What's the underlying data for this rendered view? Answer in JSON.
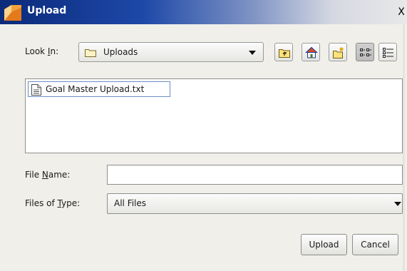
{
  "window": {
    "title": "Upload",
    "close_label": "X"
  },
  "look_in": {
    "label_pre": "Look ",
    "label_mnemonic": "I",
    "label_post": "n:",
    "value": "Uploads"
  },
  "toolbar": {
    "icons": [
      "up-one-level-icon",
      "home-icon",
      "new-folder-icon",
      "list-view-icon",
      "details-view-icon"
    ]
  },
  "files": [
    {
      "name": "Goal Master Upload.txt",
      "icon": "text-file-icon"
    }
  ],
  "file_name": {
    "label_pre": "File ",
    "label_mnemonic": "N",
    "label_post": "ame:",
    "value": ""
  },
  "files_of_type": {
    "label_pre": "Files of ",
    "label_mnemonic": "T",
    "label_post": "ype:",
    "value": "All Files"
  },
  "buttons": {
    "upload": "Upload",
    "cancel": "Cancel"
  },
  "colors": {
    "title_bar_start": "#0b2a7a",
    "background": "#f0efe9",
    "selection_border": "#6a8cc7"
  }
}
